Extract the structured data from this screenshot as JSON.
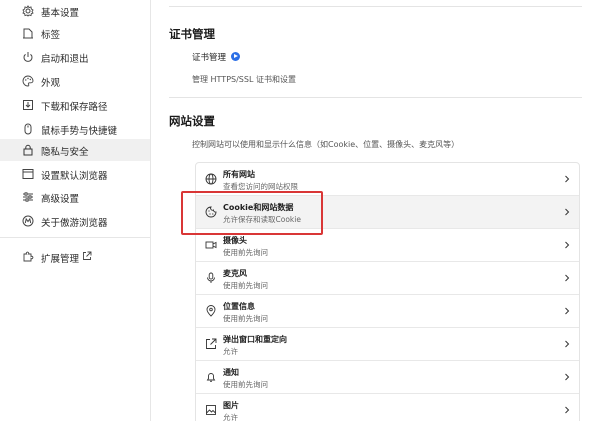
{
  "sidebar": {
    "items": [
      {
        "label": "基本设置",
        "icon": "gear-icon"
      },
      {
        "label": "标签",
        "icon": "tab-icon"
      },
      {
        "label": "启动和退出",
        "icon": "power-icon"
      },
      {
        "label": "外观",
        "icon": "palette-icon"
      },
      {
        "label": "下载和保存路径",
        "icon": "download-icon"
      },
      {
        "label": "鼠标手势与快捷键",
        "icon": "mouse-icon"
      },
      {
        "label": "隐私与安全",
        "icon": "lock-icon",
        "active": true
      },
      {
        "label": "设置默认浏览器",
        "icon": "browser-icon"
      },
      {
        "label": "高级设置",
        "icon": "sliders-icon"
      },
      {
        "label": "关于傲游浏览器",
        "icon": "maxthon-icon"
      }
    ],
    "extensions": {
      "label": "扩展管理",
      "icon": "puzzle-icon",
      "link_icon": "external-link-icon"
    }
  },
  "main": {
    "cert_section": {
      "title": "证书管理",
      "link_label": "证书管理",
      "description": "管理 HTTPS/SSL 证书和设置"
    },
    "site_section": {
      "title": "网站设置",
      "description": "控制网站可以使用和显示什么信息（如Cookie、位置、摄像头、麦克风等）",
      "rows": [
        {
          "title": "所有网站",
          "desc": "查看您访问的网站权限",
          "icon": "globe-icon"
        },
        {
          "title": "Cookie和网站数据",
          "desc": "允许保存和读取Cookie",
          "icon": "cookie-icon",
          "highlighted": true
        },
        {
          "title": "摄像头",
          "desc": "使用前先询问",
          "icon": "camera-icon"
        },
        {
          "title": "麦克风",
          "desc": "使用前先询问",
          "icon": "microphone-icon"
        },
        {
          "title": "位置信息",
          "desc": "使用前先询问",
          "icon": "location-icon"
        },
        {
          "title": "弹出窗口和重定向",
          "desc": "允许",
          "icon": "popup-icon"
        },
        {
          "title": "通知",
          "desc": "使用前先询问",
          "icon": "bell-icon"
        },
        {
          "title": "图片",
          "desc": "允许",
          "icon": "image-icon"
        }
      ]
    }
  },
  "colors": {
    "accent": "#2b6fe6",
    "highlight_border": "#d93636",
    "active_bg": "#f0f0f0"
  }
}
